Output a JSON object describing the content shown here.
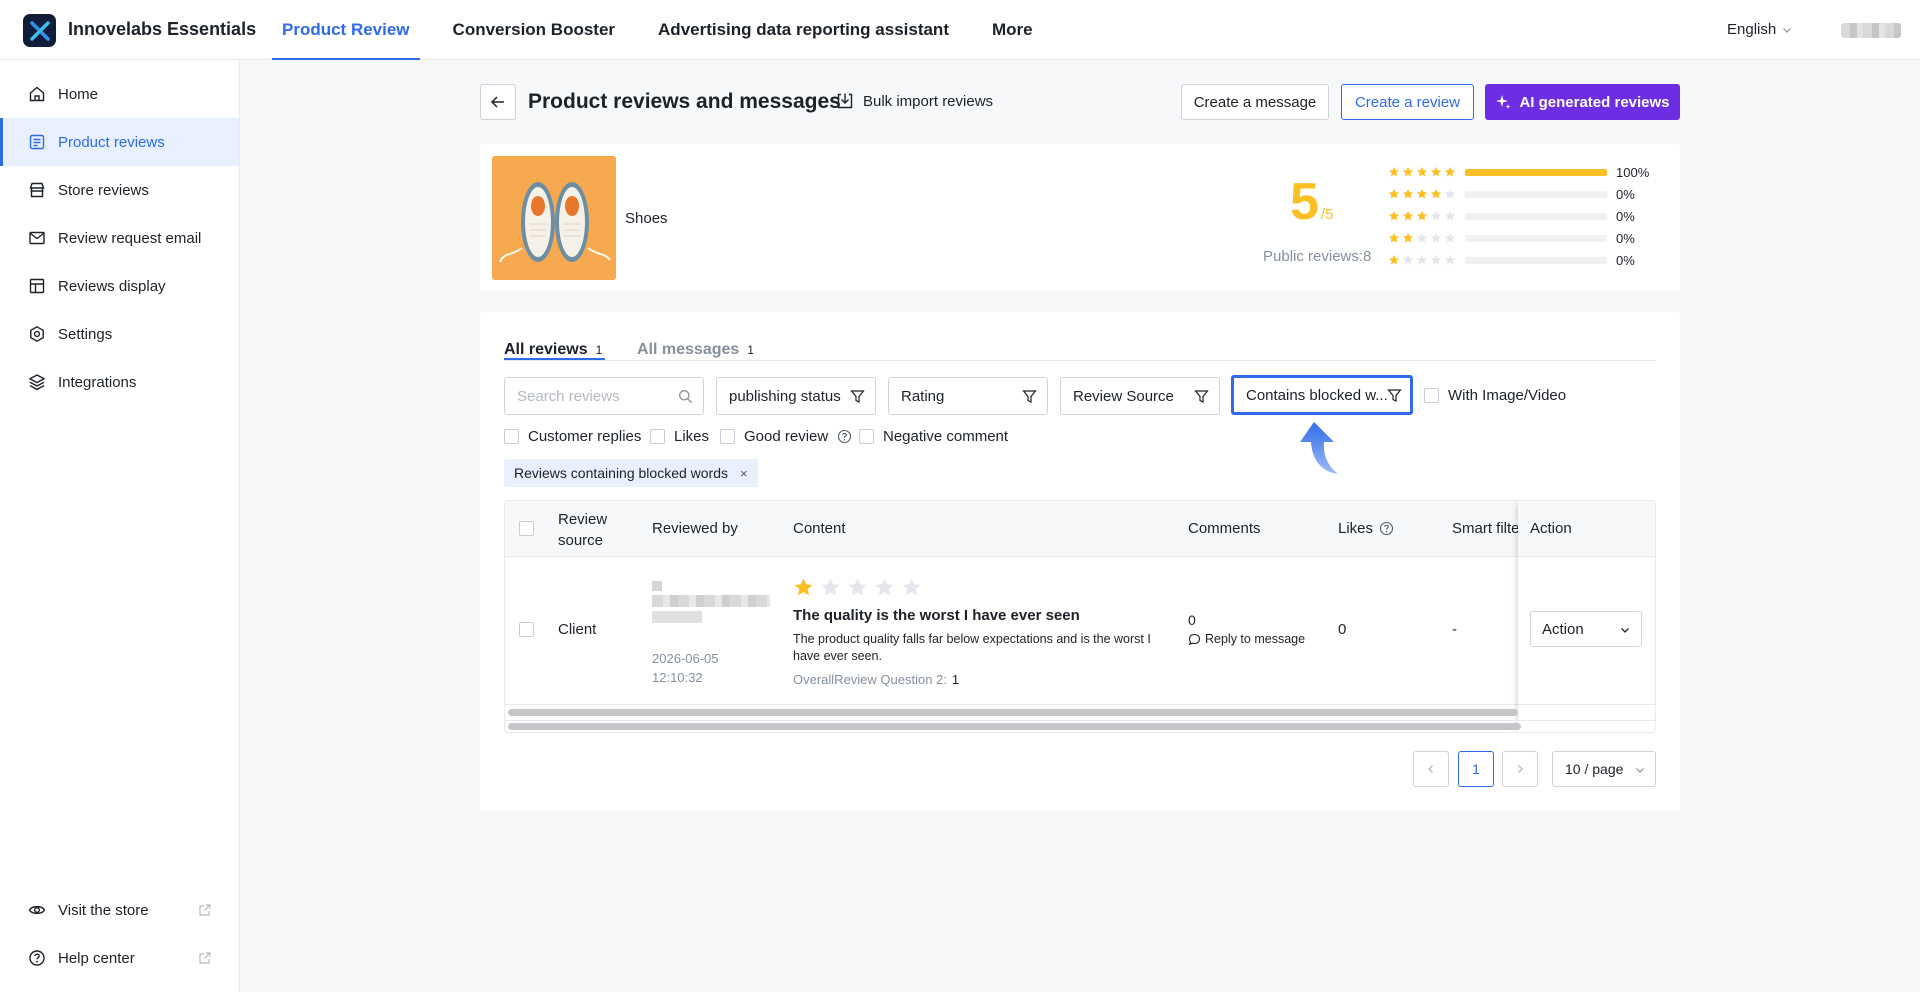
{
  "header": {
    "app_name": "Innovelabs Essentials",
    "tabs": [
      {
        "label": "Product Review",
        "active": true
      },
      {
        "label": "Conversion Booster",
        "active": false
      },
      {
        "label": "Advertising data reporting assistant",
        "active": false
      },
      {
        "label": "More",
        "active": false
      }
    ],
    "language": "English",
    "accent_color": "#2f6be8"
  },
  "sidebar": {
    "items": [
      {
        "label": "Home",
        "icon": "home-icon"
      },
      {
        "label": "Product reviews",
        "icon": "document-list-icon",
        "active": true
      },
      {
        "label": "Store reviews",
        "icon": "store-icon"
      },
      {
        "label": "Review request email",
        "icon": "mail-icon"
      },
      {
        "label": "Reviews display",
        "icon": "layout-icon"
      },
      {
        "label": "Settings",
        "icon": "settings-icon"
      },
      {
        "label": "Integrations",
        "icon": "layers-icon"
      }
    ],
    "footer_items": [
      {
        "label": "Visit the store",
        "icon": "eye-icon"
      },
      {
        "label": "Help center",
        "icon": "help-icon"
      }
    ]
  },
  "page": {
    "title": "Product reviews and messages",
    "bulk_import_label": "Bulk import reviews",
    "create_message_label": "Create a message",
    "create_review_label": "Create a review",
    "ai_reviews_label": "AI generated reviews",
    "ai_color": "#6d2ee3"
  },
  "product": {
    "name": "Shoes",
    "score": "5",
    "score_max": "/5",
    "public_reviews": "Public reviews:8",
    "distribution": [
      {
        "stars": 5,
        "percent": 100,
        "label": "100%"
      },
      {
        "stars": 4,
        "percent": 0,
        "label": "0%"
      },
      {
        "stars": 3,
        "percent": 0,
        "label": "0%"
      },
      {
        "stars": 2,
        "percent": 0,
        "label": "0%"
      },
      {
        "stars": 1,
        "percent": 0,
        "label": "0%"
      }
    ]
  },
  "reviews": {
    "tabs": [
      {
        "label": "All reviews",
        "count": "1",
        "active": true
      },
      {
        "label": "All messages",
        "count": "1",
        "active": false
      }
    ],
    "search_placeholder": "Search reviews",
    "filters": {
      "publishing_status": "publishing status",
      "rating": "Rating",
      "review_source": "Review Source",
      "blocked_words": "Contains blocked w...",
      "with_media": "With Image/Video"
    },
    "checkboxes": [
      "Customer replies",
      "Likes",
      "Good review",
      "Negative comment"
    ],
    "active_tag": "Reviews containing blocked words",
    "columns": {
      "source": "Review source",
      "reviewed_by": "Reviewed by",
      "content": "Content",
      "comments": "Comments",
      "likes": "Likes",
      "smart_filter": "Smart filte",
      "action": "Action"
    },
    "rows": [
      {
        "source": "Client",
        "date": "2026-06-05",
        "time": "12:10:32",
        "rating": 1,
        "title": "The quality is the worst I have ever seen",
        "body": "The product quality falls far below expectations and is the worst I have ever seen.",
        "question_label": "OverallReview Question 2:",
        "question_value": "1",
        "comments": "0",
        "reply_label": "Reply to message",
        "likes": "0",
        "smart_filter": "-",
        "action_label": "Action"
      }
    ]
  },
  "pagination": {
    "current_page": "1",
    "page_size": "10 / page"
  },
  "star_color": "#fbbf24",
  "highlight_color": "#2f6be8"
}
